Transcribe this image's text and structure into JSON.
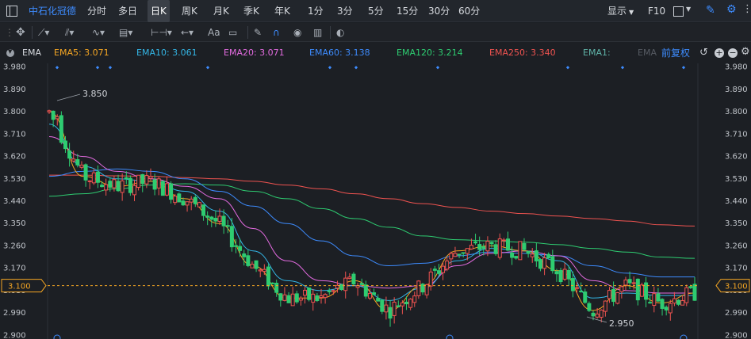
{
  "header": {
    "stock_name": "中石化冠德",
    "periods": [
      "分时",
      "多日",
      "日K",
      "周K",
      "月K",
      "季K",
      "年K",
      "1分",
      "3分",
      "5分",
      "15分",
      "30分",
      "60分"
    ],
    "active_period": "日K",
    "display_label": "显示",
    "f10_label": "F10"
  },
  "toolbar": {
    "text_tool": "Aa"
  },
  "indicators": {
    "name": "EMA",
    "items": [
      {
        "label": "EMA5:",
        "value": "3.071",
        "color": "#f5a623"
      },
      {
        "label": "EMA10:",
        "value": "3.061",
        "color": "#33b5e5"
      },
      {
        "label": "EMA20:",
        "value": "3.071",
        "color": "#e36be0"
      },
      {
        "label": "EMA60:",
        "value": "3.138",
        "color": "#3d8bfd"
      },
      {
        "label": "EMA120:",
        "value": "3.214",
        "color": "#2ecc71"
      },
      {
        "label": "EMA250:",
        "value": "3.340",
        "color": "#ef5350"
      },
      {
        "label": "EMA1:",
        "value": "",
        "color": "#5fb3a8"
      },
      {
        "label": "EMA",
        "value": "",
        "color": "#555a62"
      }
    ],
    "adjust_label": "前复权"
  },
  "price_axis": {
    "ticks": [
      "3.980",
      "3.890",
      "3.800",
      "3.710",
      "3.620",
      "3.530",
      "3.440",
      "3.350",
      "3.260",
      "3.170",
      "3.080",
      "2.990",
      "2.900"
    ],
    "current_price": "3.100"
  },
  "annotations": {
    "high": "3.850",
    "low": "2.950"
  },
  "colors": {
    "up": "#ef5350",
    "down": "#2ecc71",
    "price_line": "#f5a623"
  },
  "chart_data": {
    "type": "candlestick",
    "ylim": [
      2.885,
      3.995
    ],
    "ema_lines": [
      {
        "name": "EMA250",
        "color": "#ef5350",
        "values": [
          3.545,
          3.545,
          3.542,
          3.54,
          3.535,
          3.53,
          3.52,
          3.505,
          3.49,
          3.47,
          3.45,
          3.43,
          3.415,
          3.4,
          3.39,
          3.38,
          3.37,
          3.36,
          3.345,
          3.34
        ]
      },
      {
        "name": "EMA120",
        "color": "#2ecc71",
        "values": [
          3.46,
          3.47,
          3.49,
          3.505,
          3.51,
          3.505,
          3.48,
          3.45,
          3.41,
          3.37,
          3.335,
          3.3,
          3.285,
          3.28,
          3.275,
          3.265,
          3.25,
          3.235,
          3.215,
          3.21
        ]
      },
      {
        "name": "EMA60",
        "color": "#3d8bfd",
        "values": [
          3.54,
          3.56,
          3.57,
          3.56,
          3.53,
          3.48,
          3.42,
          3.35,
          3.28,
          3.22,
          3.18,
          3.19,
          3.22,
          3.235,
          3.23,
          3.22,
          3.18,
          3.15,
          3.135,
          3.135
        ]
      },
      {
        "name": "EMA20",
        "color": "#e36be0",
        "values": [
          3.7,
          3.62,
          3.56,
          3.53,
          3.5,
          3.45,
          3.33,
          3.2,
          3.12,
          3.1,
          3.09,
          3.1,
          3.18,
          3.23,
          3.24,
          3.22,
          3.12,
          3.08,
          3.07,
          3.07
        ]
      },
      {
        "name": "EMA10",
        "color": "#33b5e5",
        "values": [
          3.75,
          3.58,
          3.53,
          3.52,
          3.48,
          3.4,
          3.24,
          3.12,
          3.08,
          3.1,
          3.04,
          3.09,
          3.2,
          3.25,
          3.24,
          3.2,
          3.05,
          3.07,
          3.06,
          3.06
        ]
      },
      {
        "name": "EMA5",
        "color": "#f5a623",
        "values": [
          3.8,
          3.54,
          3.5,
          3.52,
          3.45,
          3.35,
          3.18,
          3.05,
          3.05,
          3.12,
          3.0,
          3.1,
          3.24,
          3.26,
          3.24,
          3.16,
          3.0,
          3.1,
          3.03,
          3.07
        ]
      }
    ]
  }
}
